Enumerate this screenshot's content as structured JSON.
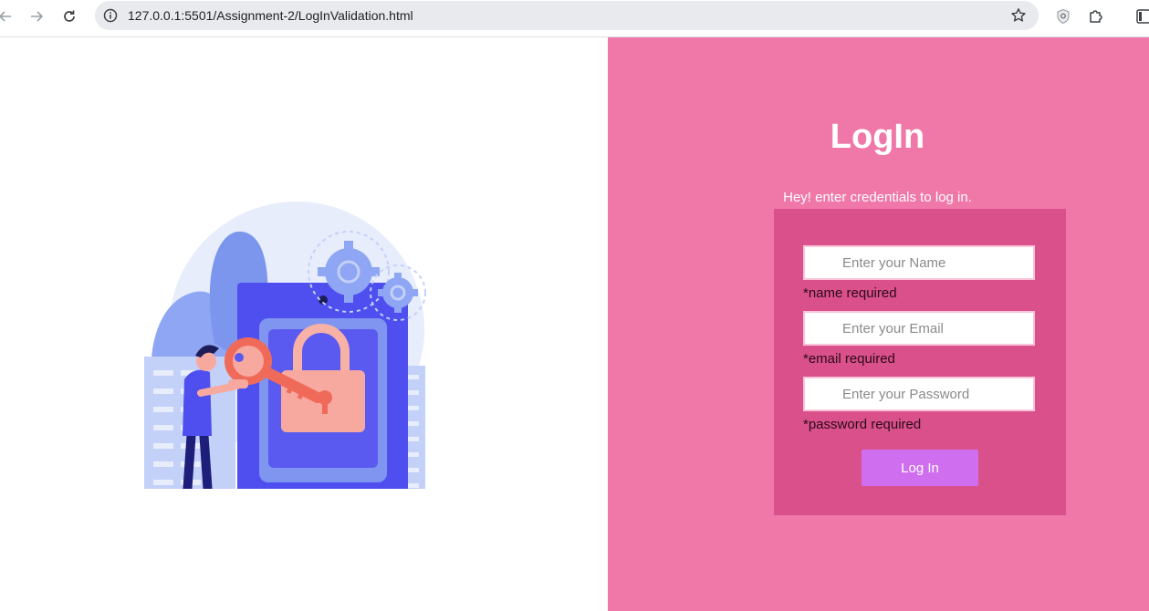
{
  "browser": {
    "url": "127.0.0.1:5501/Assignment-2/LogInValidation.html",
    "icons": [
      "back-arrow-icon",
      "forward-arrow-icon",
      "reload-icon",
      "site-info-icon",
      "bookmark-star-icon",
      "shield-extension-icon",
      "extensions-puzzle-icon",
      "side-panel-icon"
    ]
  },
  "login": {
    "title": "LogIn",
    "subtitle": "Hey! enter credentials to log in.",
    "name_placeholder": "Enter your Name",
    "name_error": "*name required",
    "email_placeholder": "Enter your Email",
    "email_error": "*email required",
    "password_placeholder": "Enter your Password",
    "password_error": "*password required",
    "button_label": "Log In"
  },
  "colors": {
    "right_pane_bg": "#ef78a8",
    "form_bg": "#d9508b",
    "button_bg": "#d06ef0"
  }
}
